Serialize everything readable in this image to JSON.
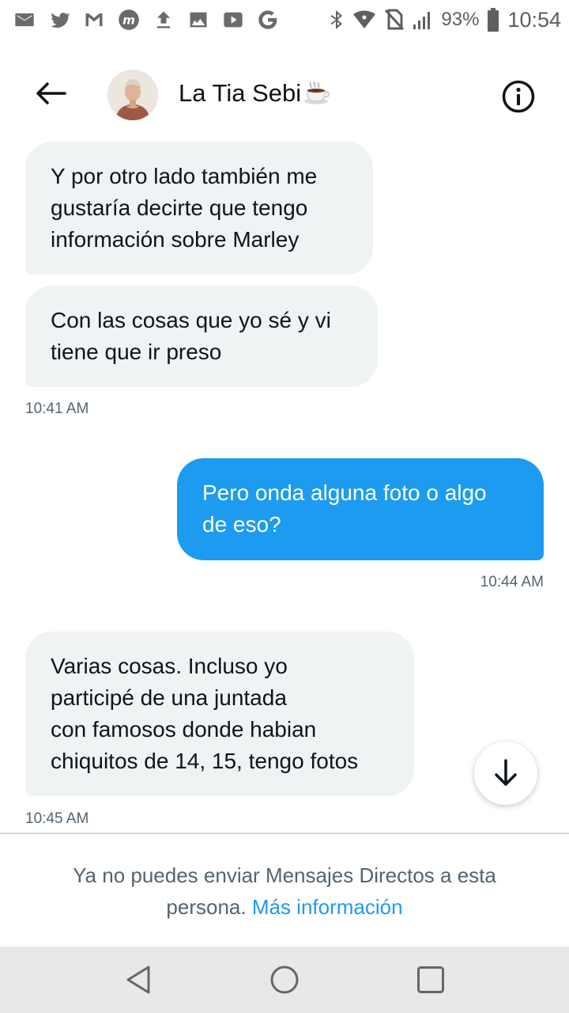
{
  "status_bar": {
    "icons": [
      "gmail-icon",
      "twitter-icon",
      "gmail-alt-icon",
      "m-app-icon",
      "upload-icon",
      "image-icon",
      "youtube-icon",
      "google-icon"
    ],
    "battery_percent": "93%",
    "time": "10:54"
  },
  "header": {
    "contact_name": "La Tia Sebi",
    "name_emoji": "coffee-icon"
  },
  "messages": [
    {
      "direction": "incoming",
      "text": "Y por otro lado también me\ngustaría decirte que tengo\ninformación sobre Marley"
    },
    {
      "direction": "incoming",
      "text": "Con las cosas que yo sé y vi\ntiene que ir preso"
    },
    {
      "direction": "outgoing",
      "text": "Pero onda alguna foto o algo\nde eso?"
    },
    {
      "direction": "incoming",
      "text": "Varias cosas. Incluso yo\nparticipé de una juntada\ncon famosos donde habian\nchiquitos de 14, 15, tengo fotos"
    }
  ],
  "timestamps": [
    "10:41 AM",
    "10:44 AM",
    "10:45 AM"
  ],
  "footer": {
    "notice_text": "Ya no puedes enviar Mensajes Directos a esta persona.",
    "link_text": "Más información"
  },
  "colors": {
    "accent": "#1d9bf0",
    "incoming_bubble": "#eff3f4",
    "secondary_text": "#536471"
  }
}
